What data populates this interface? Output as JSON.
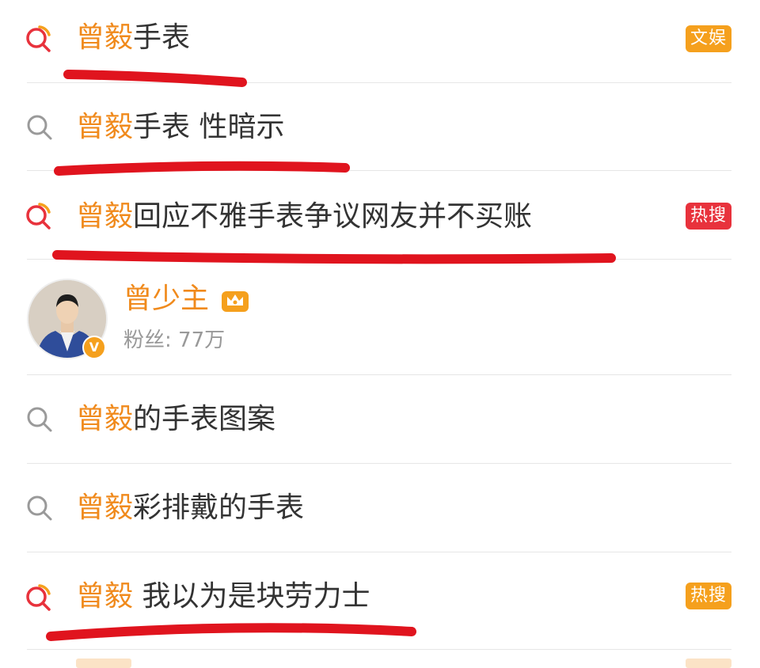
{
  "results": [
    {
      "highlight": "曾毅",
      "rest": "手表",
      "badge": "文娱",
      "badge_color": "#f5a01d",
      "hot": true
    },
    {
      "highlight": "曾毅",
      "rest": "手表 性暗示",
      "badge": "",
      "badge_color": "",
      "hot": false
    },
    {
      "highlight": "曾毅",
      "rest": "回应不雅手表争议网友并不买账",
      "badge": "热搜",
      "badge_color": "#e8323c",
      "hot": true
    },
    {
      "highlight": "曾毅",
      "rest": "的手表图案",
      "badge": "",
      "badge_color": "",
      "hot": false
    },
    {
      "highlight": "曾毅",
      "rest": "彩排戴的手表",
      "badge": "",
      "badge_color": "",
      "hot": false
    },
    {
      "highlight": "曾毅",
      "rest": " 我以为是块劳力士",
      "badge": "热搜",
      "badge_color": "#f5a01d",
      "hot": true
    }
  ],
  "user": {
    "name": "曾少主",
    "fans": "粉丝: 77万",
    "verified_icon": "V"
  },
  "colors": {
    "highlight": "#f08a1c",
    "underline": "#e0141e"
  }
}
